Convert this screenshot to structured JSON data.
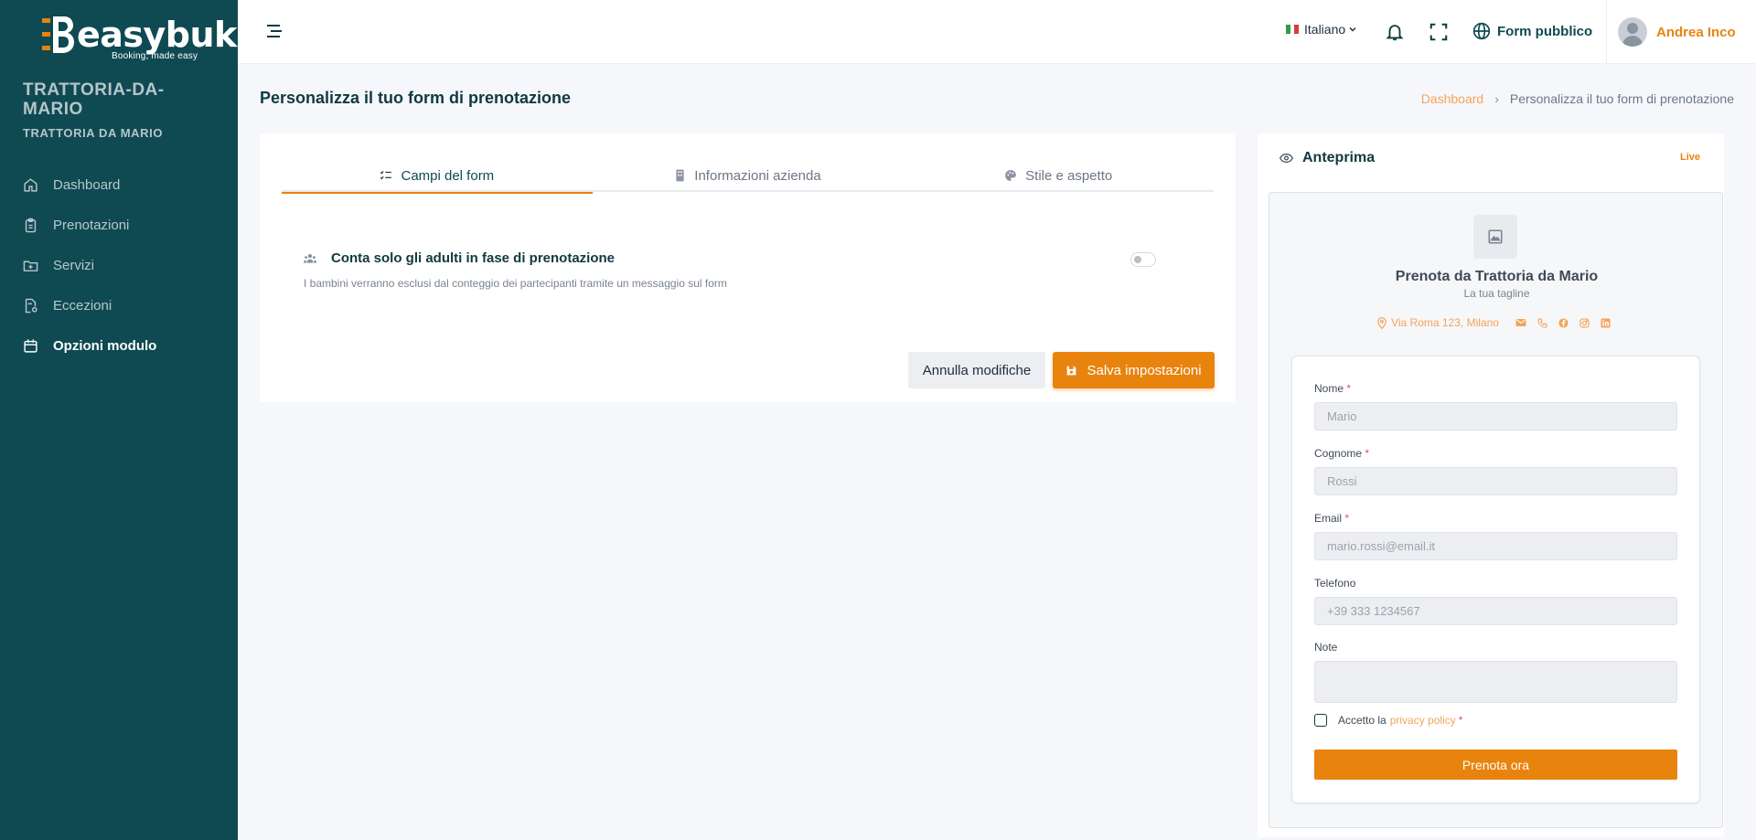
{
  "brand": {
    "name": "easybuk",
    "tagline": "Booking, made easy"
  },
  "tenant": {
    "slug": "TRATTORIA-DA-MARIO",
    "name": "TRATTORIA DA MARIO"
  },
  "sidebar": {
    "items": [
      {
        "label": "Dashboard",
        "icon": "home-icon"
      },
      {
        "label": "Prenotazioni",
        "icon": "clipboard-icon"
      },
      {
        "label": "Servizi",
        "icon": "folder-plus-icon"
      },
      {
        "label": "Eccezioni",
        "icon": "document-gear-icon"
      },
      {
        "label": "Opzioni modulo",
        "icon": "calendar-icon",
        "active": true
      }
    ]
  },
  "topbar": {
    "language": "Italiano",
    "public_form": "Form pubblico",
    "user": "Andrea Inco"
  },
  "page": {
    "title": "Personalizza il tuo form di prenotazione",
    "breadcrumb": {
      "home": "Dashboard",
      "current": "Personalizza il tuo form di prenotazione"
    }
  },
  "tabs": [
    {
      "label": "Campi del form",
      "icon": "list-check-icon",
      "active": true
    },
    {
      "label": "Informazioni azienda",
      "icon": "building-icon"
    },
    {
      "label": "Stile e aspetto",
      "icon": "palette-icon"
    }
  ],
  "setting": {
    "label": "Conta solo gli adulti in fase di prenotazione",
    "description": "I bambini verranno esclusi dal conteggio dei partecipanti tramite un messaggio sul form",
    "enabled": false
  },
  "actions": {
    "cancel": "Annulla modifiche",
    "save": "Salva impostazioni"
  },
  "preview": {
    "title": "Anteprima",
    "badge": "Live",
    "business_name": "Prenota da Trattoria da Mario",
    "business_tagline": "La tua tagline",
    "address": "Via Roma 123, Milano",
    "fields": [
      {
        "label": "Nome",
        "required": "*",
        "placeholder": "Mario"
      },
      {
        "label": "Cognome",
        "required": "*",
        "placeholder": "Rossi"
      },
      {
        "label": "Email",
        "required": "*",
        "placeholder": "mario.rossi@email.it"
      },
      {
        "label": "Telefono",
        "required": "",
        "placeholder": "+39 333 1234567"
      },
      {
        "label": "Note",
        "required": "",
        "placeholder": ""
      }
    ],
    "privacy_prefix": "Accetto la",
    "privacy_link": "privacy policy",
    "privacy_required": "*",
    "submit": "Prenota ora"
  },
  "colors": {
    "sidebar": "#0f4a52",
    "accent": "#e8830e",
    "accent_light": "#f3a45a",
    "required": "#e05252"
  }
}
